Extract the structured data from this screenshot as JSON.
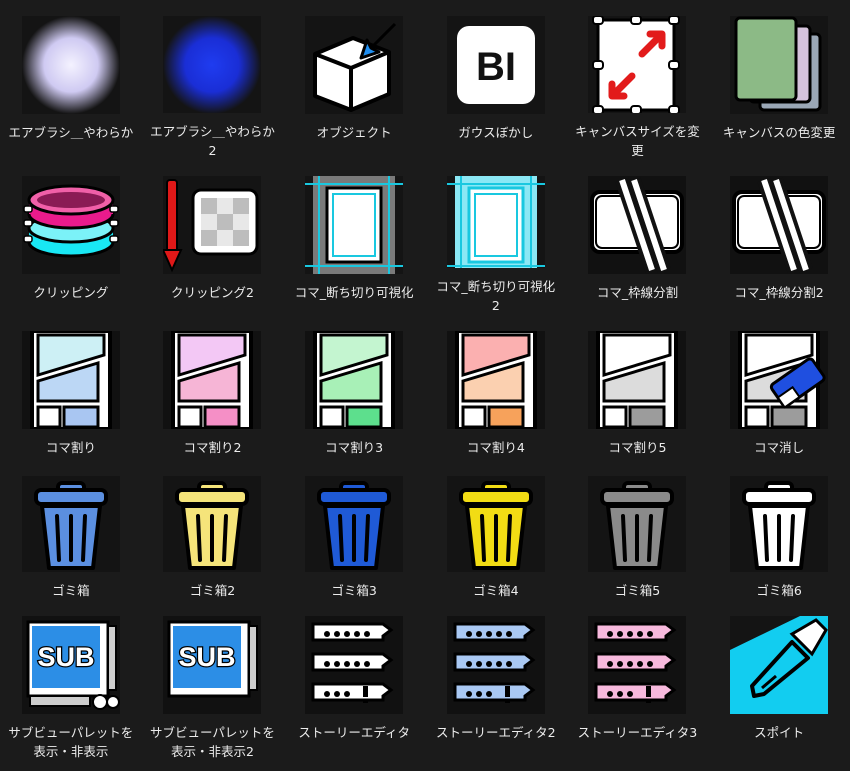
{
  "items": [
    {
      "label": "エアブラシ＿やわらか",
      "icon": "airbrush-soft-white-icon"
    },
    {
      "label": "エアブラシ＿やわらか2",
      "icon": "airbrush-soft-blue-icon"
    },
    {
      "label": "オブジェクト",
      "icon": "object-cube-icon"
    },
    {
      "label": "ガウスぼかし",
      "icon": "gaussian-blur-icon",
      "text": "BI"
    },
    {
      "label": "キャンバスサイズを変更",
      "icon": "canvas-resize-icon"
    },
    {
      "label": "キャンバスの色変更",
      "icon": "canvas-color-icon"
    },
    {
      "label": "クリッピング",
      "icon": "clipping-icon"
    },
    {
      "label": "クリッピング2",
      "icon": "clipping2-icon"
    },
    {
      "label": "コマ_断ち切り可視化",
      "icon": "panel-bleed-gray-icon"
    },
    {
      "label": "コマ_断ち切り可視化2",
      "icon": "panel-bleed-cyan-icon"
    },
    {
      "label": "コマ_枠線分割",
      "icon": "panel-split-icon"
    },
    {
      "label": "コマ_枠線分割2",
      "icon": "panel-split2-icon"
    },
    {
      "label": "コマ割り",
      "icon": "panel-layout-blue-icon"
    },
    {
      "label": "コマ割り2",
      "icon": "panel-layout-pink-icon"
    },
    {
      "label": "コマ割り3",
      "icon": "panel-layout-green-icon"
    },
    {
      "label": "コマ割り4",
      "icon": "panel-layout-orange-icon"
    },
    {
      "label": "コマ割り5",
      "icon": "panel-layout-gray-icon"
    },
    {
      "label": "コマ消し",
      "icon": "panel-erase-icon"
    },
    {
      "label": "ゴミ箱",
      "icon": "trash-lightblue-icon"
    },
    {
      "label": "ゴミ箱2",
      "icon": "trash-lightyellow-icon"
    },
    {
      "label": "ゴミ箱3",
      "icon": "trash-blue-icon"
    },
    {
      "label": "ゴミ箱4",
      "icon": "trash-yellow-icon"
    },
    {
      "label": "ゴミ箱5",
      "icon": "trash-gray-icon"
    },
    {
      "label": "ゴミ箱6",
      "icon": "trash-white-icon"
    },
    {
      "label": "サブビューパレットを表示・非表示",
      "icon": "sub-view-palette-icon",
      "text": "SUB"
    },
    {
      "label": "サブビューパレットを表示・非表示2",
      "icon": "sub-view-palette2-icon",
      "text": "SUB"
    },
    {
      "label": "ストーリーエディタ",
      "icon": "story-editor-white-icon"
    },
    {
      "label": "ストーリーエディタ2",
      "icon": "story-editor-blue-icon"
    },
    {
      "label": "ストーリーエディタ3",
      "icon": "story-editor-pink-icon"
    },
    {
      "label": "スポイト",
      "icon": "eyedropper-icon"
    }
  ],
  "colors": {
    "background": "#1b1b1b",
    "trash": [
      "#5b8fe0",
      "#f5e47a",
      "#1f5ad6",
      "#f2dc14",
      "#8a8a8a",
      "#ffffff"
    ],
    "panel_layout": [
      [
        "#cdf0f5",
        "#bcd7f5",
        "#a9c6f2"
      ],
      [
        "#f3c8f5",
        "#f6b5d6",
        "#f58fc6"
      ],
      [
        "#c4f5d0",
        "#a8f0b7",
        "#5ddf8d"
      ],
      [
        "#fbb0b0",
        "#fbd0b0",
        "#f7a25b"
      ],
      [
        "#ffffff",
        "#dcdcdc",
        "#9c9c9c"
      ]
    ],
    "story_editor": [
      "#ffffff",
      "#a9c8f3",
      "#f7b9dd"
    ]
  }
}
